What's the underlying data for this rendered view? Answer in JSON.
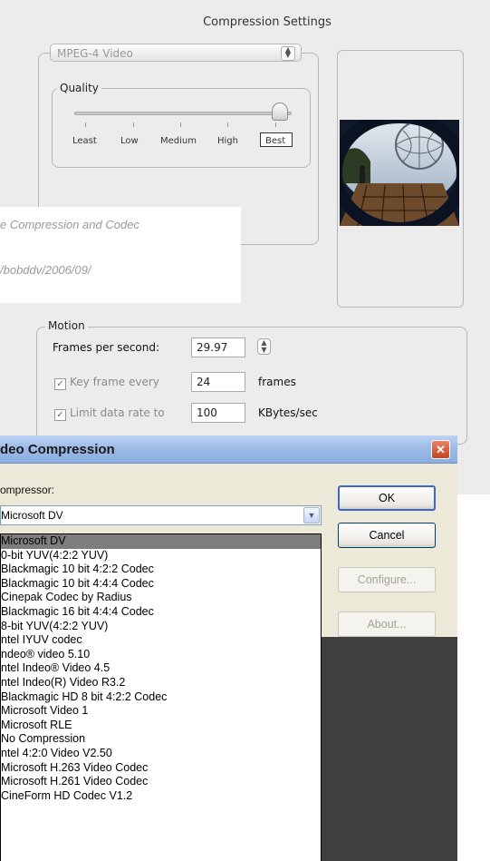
{
  "mac_dialog": {
    "title": "Compression Settings",
    "codec_popup": "MPEG-4 Video",
    "quality": {
      "legend": "Quality",
      "labels": [
        "Least",
        "Low",
        "Medium",
        "High",
        "Best"
      ],
      "selected": "Best"
    },
    "motion": {
      "legend": "Motion",
      "fps_label": "Frames per second:",
      "fps_value": "29.97",
      "keyframe_label": "Key frame every",
      "keyframe_value": "24",
      "keyframe_unit": "frames",
      "datarate_label": "Limit data rate to",
      "datarate_value": "100",
      "datarate_unit": "KBytes/sec",
      "check_glyph": "✓"
    }
  },
  "overlay": {
    "line1": "e Compression and Codec",
    "line2": "/bobddv/2006/09/"
  },
  "win_dialog": {
    "title": "deo Compression",
    "compressor_label": "ompressor:",
    "selected_compressor": "Microsoft DV",
    "buttons": {
      "ok": "OK",
      "cancel": "Cancel",
      "configure": "Configure...",
      "about": "About..."
    },
    "list_items": [
      "Microsoft DV",
      "0-bit YUV(4:2:2 YUV)",
      "Blackmagic 10 bit 4:2:2 Codec",
      "Blackmagic 10 bit 4:4:4 Codec",
      "Cinepak Codec by Radius",
      "Blackmagic 16 bit 4:4:4 Codec",
      "8-bit YUV(4:2:2 YUV)",
      "ntel IYUV codec",
      "ndeo® video 5.10",
      "ntel Indeo® Video 4.5",
      "ntel Indeo(R) Video R3.2",
      "Blackmagic HD 8 bit 4:2:2 Codec",
      "Microsoft Video 1",
      "Microsoft RLE",
      "No Compression",
      "ntel 4:2:0 Video V2.50",
      "Microsoft H.263 Video Codec",
      "Microsoft H.261 Video Codec",
      "CineForm HD Codec V1.2"
    ],
    "selected_index": 0,
    "close_glyph": "✕",
    "dropdown_glyph": "▼"
  }
}
